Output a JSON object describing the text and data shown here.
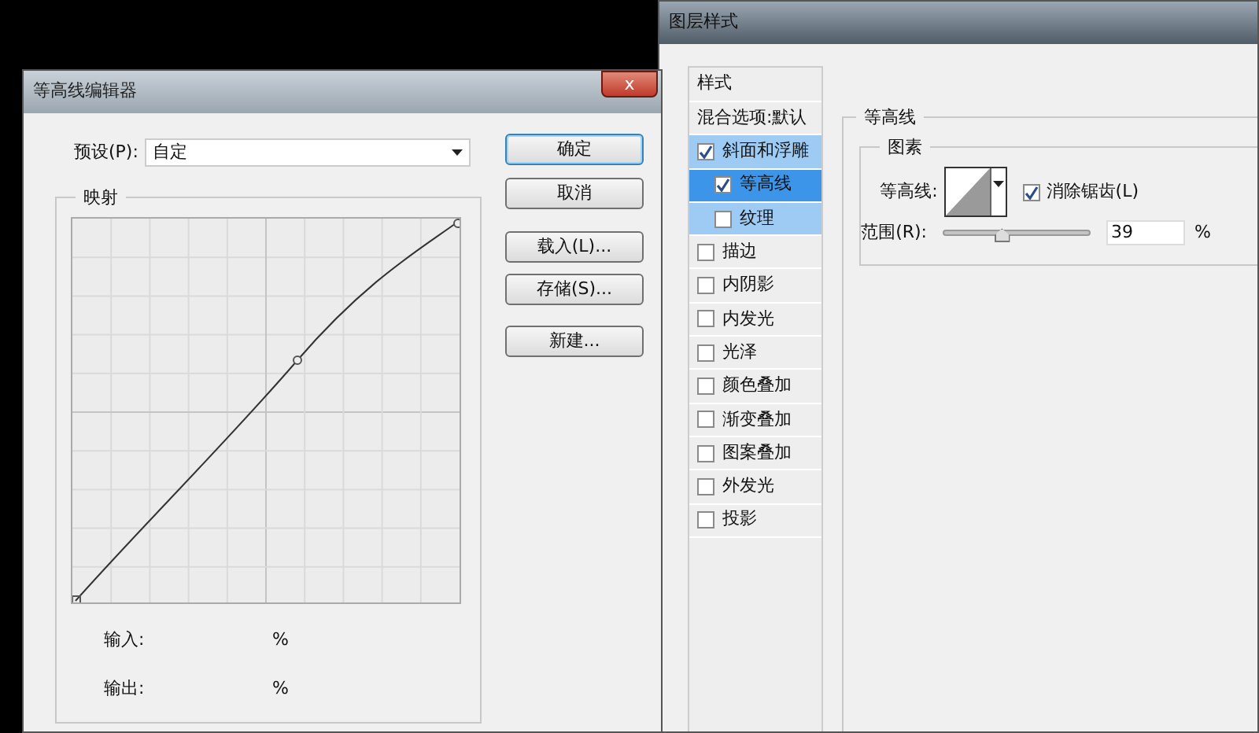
{
  "contour_editor": {
    "title": "等高线编辑器",
    "close": "x",
    "preset": {
      "label": "预设(P):",
      "value": "自定"
    },
    "buttons": [
      {
        "label": "确定",
        "default": true
      },
      {
        "label": "取消",
        "default": false
      },
      {
        "label": "载入(L)...",
        "default": false
      },
      {
        "label": "存储(S)...",
        "default": false
      },
      {
        "label": "新建...",
        "default": false
      }
    ],
    "mapping": {
      "title": "映射",
      "input_label": "输入:",
      "input_unit": "%",
      "output_label": "输出:",
      "output_unit": "%"
    }
  },
  "layer_style": {
    "title": "图层样式",
    "styles": [
      {
        "kind": "header",
        "label": "样式"
      },
      {
        "kind": "plain",
        "label": "混合选项:默认"
      },
      {
        "kind": "check",
        "label": "斜面和浮雕",
        "checked": true,
        "selected": false,
        "children": [
          {
            "kind": "check",
            "label": "等高线",
            "checked": true,
            "selected": true
          },
          {
            "kind": "check",
            "label": "纹理",
            "checked": false,
            "selected": false
          }
        ]
      },
      {
        "kind": "check",
        "label": "描边",
        "checked": false,
        "selected": false
      },
      {
        "kind": "check",
        "label": "内阴影",
        "checked": false,
        "selected": false
      },
      {
        "kind": "check",
        "label": "内发光",
        "checked": false,
        "selected": false
      },
      {
        "kind": "check",
        "label": "光泽",
        "checked": false,
        "selected": false
      },
      {
        "kind": "check",
        "label": "颜色叠加",
        "checked": false,
        "selected": false
      },
      {
        "kind": "check",
        "label": "渐变叠加",
        "checked": false,
        "selected": false
      },
      {
        "kind": "check",
        "label": "图案叠加",
        "checked": false,
        "selected": false
      },
      {
        "kind": "check",
        "label": "外发光",
        "checked": false,
        "selected": false
      },
      {
        "kind": "check",
        "label": "投影",
        "checked": false,
        "selected": false
      }
    ],
    "section_title": "等高线",
    "group_title": "图素",
    "contour_label": "等高线:",
    "antialias": {
      "label": "消除锯齿(L)",
      "checked": true
    },
    "range": {
      "label": "范围(R):",
      "level": 0.39,
      "value": "39",
      "unit": "%"
    }
  }
}
